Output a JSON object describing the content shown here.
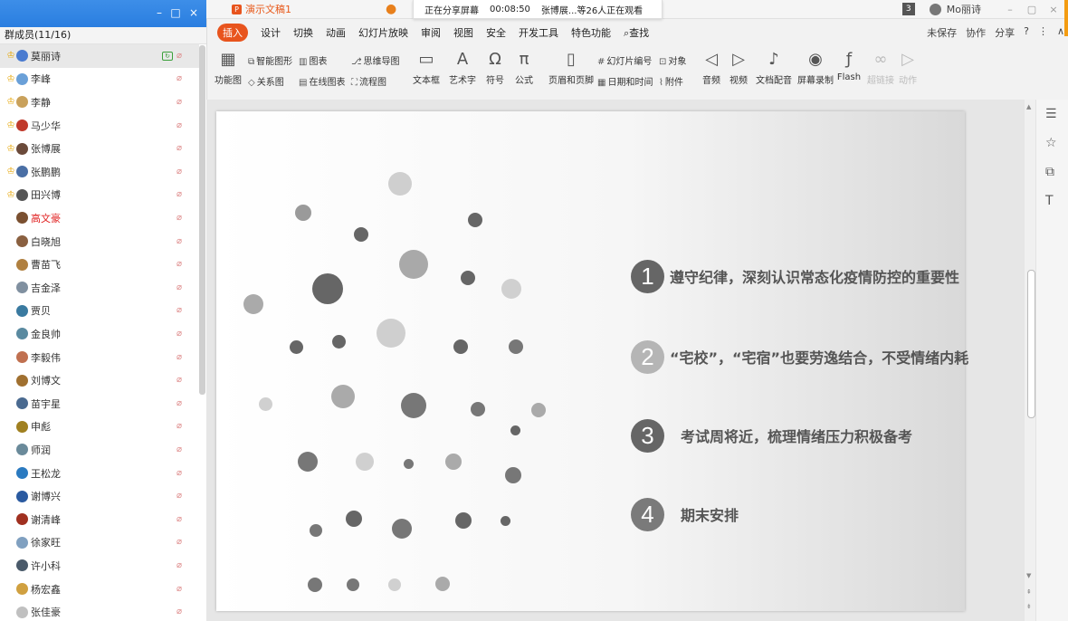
{
  "sidebar": {
    "header": "群成员(11/16)",
    "window_buttons": {
      "min": "–",
      "max": "□",
      "close": "×"
    },
    "members": [
      {
        "name": "莫丽诗",
        "role": "teacher",
        "selected": true,
        "sharing": true,
        "avatar_color": "#4a7bd0"
      },
      {
        "name": "李峰",
        "role": "teacher",
        "avatar_color": "#6aa0d8"
      },
      {
        "name": "李静",
        "role": "teacher",
        "avatar_color": "#c9a15b"
      },
      {
        "name": "马少华",
        "role": "teacher",
        "avatar_color": "#c0392b"
      },
      {
        "name": "张博展",
        "role": "teacher",
        "avatar_color": "#6b4a3a"
      },
      {
        "name": "张鹏鹏",
        "role": "teacher",
        "avatar_color": "#4a6fa5"
      },
      {
        "name": "田兴博",
        "role": "teacher",
        "avatar_color": "#555555"
      },
      {
        "name": "高文豪",
        "red": true,
        "avatar_color": "#7a5030"
      },
      {
        "name": "白晓旭",
        "avatar_color": "#8a6040"
      },
      {
        "name": "曹苗飞",
        "avatar_color": "#b08040"
      },
      {
        "name": "吉金泽",
        "avatar_color": "#8090a0"
      },
      {
        "name": "贾贝",
        "avatar_color": "#3a7aa0"
      },
      {
        "name": "金良帅",
        "avatar_color": "#5a8aa0"
      },
      {
        "name": "李毅伟",
        "avatar_color": "#c07050"
      },
      {
        "name": "刘博文",
        "avatar_color": "#a07030"
      },
      {
        "name": "苗宇星",
        "avatar_color": "#4a6a90"
      },
      {
        "name": "申彪",
        "avatar_color": "#a08020"
      },
      {
        "name": "师润",
        "avatar_color": "#6a8a9a"
      },
      {
        "name": "王松龙",
        "avatar_color": "#2a7ac0"
      },
      {
        "name": "谢博兴",
        "avatar_color": "#2a5aa0"
      },
      {
        "name": "谢清峰",
        "avatar_color": "#a03020"
      },
      {
        "name": "徐家旺",
        "avatar_color": "#80a0c0"
      },
      {
        "name": "许小科",
        "avatar_color": "#4a5a6a"
      },
      {
        "name": "杨宏鑫",
        "avatar_color": "#d0a040"
      },
      {
        "name": "张佳豪",
        "avatar_color": "#c0c0c0"
      }
    ]
  },
  "app": {
    "doc_tab": {
      "icon": "P",
      "title": "演示文稿1"
    },
    "share_banner": {
      "status": "正在分享屏幕",
      "time": "00:08:50",
      "viewers": "张博展...等26人正在观看"
    },
    "tab_right": {
      "badge": "3",
      "user": "Mo丽诗",
      "min": "–",
      "restore": "▢",
      "close": "×"
    },
    "menu": [
      "插入",
      "设计",
      "切换",
      "动画",
      "幻灯片放映",
      "审阅",
      "视图",
      "安全",
      "开发工具",
      "特色功能",
      "查找"
    ],
    "active_menu": "插入",
    "search_icon": "⌕",
    "menu_right": {
      "save": "未保存",
      "collab": "协作",
      "share": "分享",
      "help": "?",
      "more": "⋮",
      "collapse": "∧"
    },
    "ribbon": {
      "feature_chart": "功能图",
      "smart_shape": "智能图形",
      "chart": "图表",
      "mindmap": "思维导图",
      "relation": "关系图",
      "online_chart": "在线图表",
      "flowchart": "流程图",
      "textbox": "文本框",
      "wordart": "艺术字",
      "symbol": "符号",
      "formula": "公式",
      "header_footer": "页眉和页脚",
      "slide_number": "幻灯片编号",
      "object": "对象",
      "datetime": "日期和时间",
      "attachment": "附件",
      "audio": "音频",
      "video": "视频",
      "dubbing": "文档配音",
      "screen_record": "屏幕录制",
      "flash": "Flash",
      "hyperlink": "超链接",
      "action": "动作"
    },
    "slide": {
      "agenda": [
        {
          "num": "1",
          "text": "遵守纪律，深刻认识常态化疫情防控的重要性",
          "color": "#666666"
        },
        {
          "num": "2",
          "text": "“宅校”，“宅宿”也要劳逸结合，不受情绪内耗",
          "color": "#b5b5b5"
        },
        {
          "num": "3",
          "text": "考试周将近，梳理情绪压力积极备考",
          "color": "#666666"
        },
        {
          "num": "4",
          "text": "期末安排",
          "color": "#7a7a7a"
        }
      ]
    }
  }
}
